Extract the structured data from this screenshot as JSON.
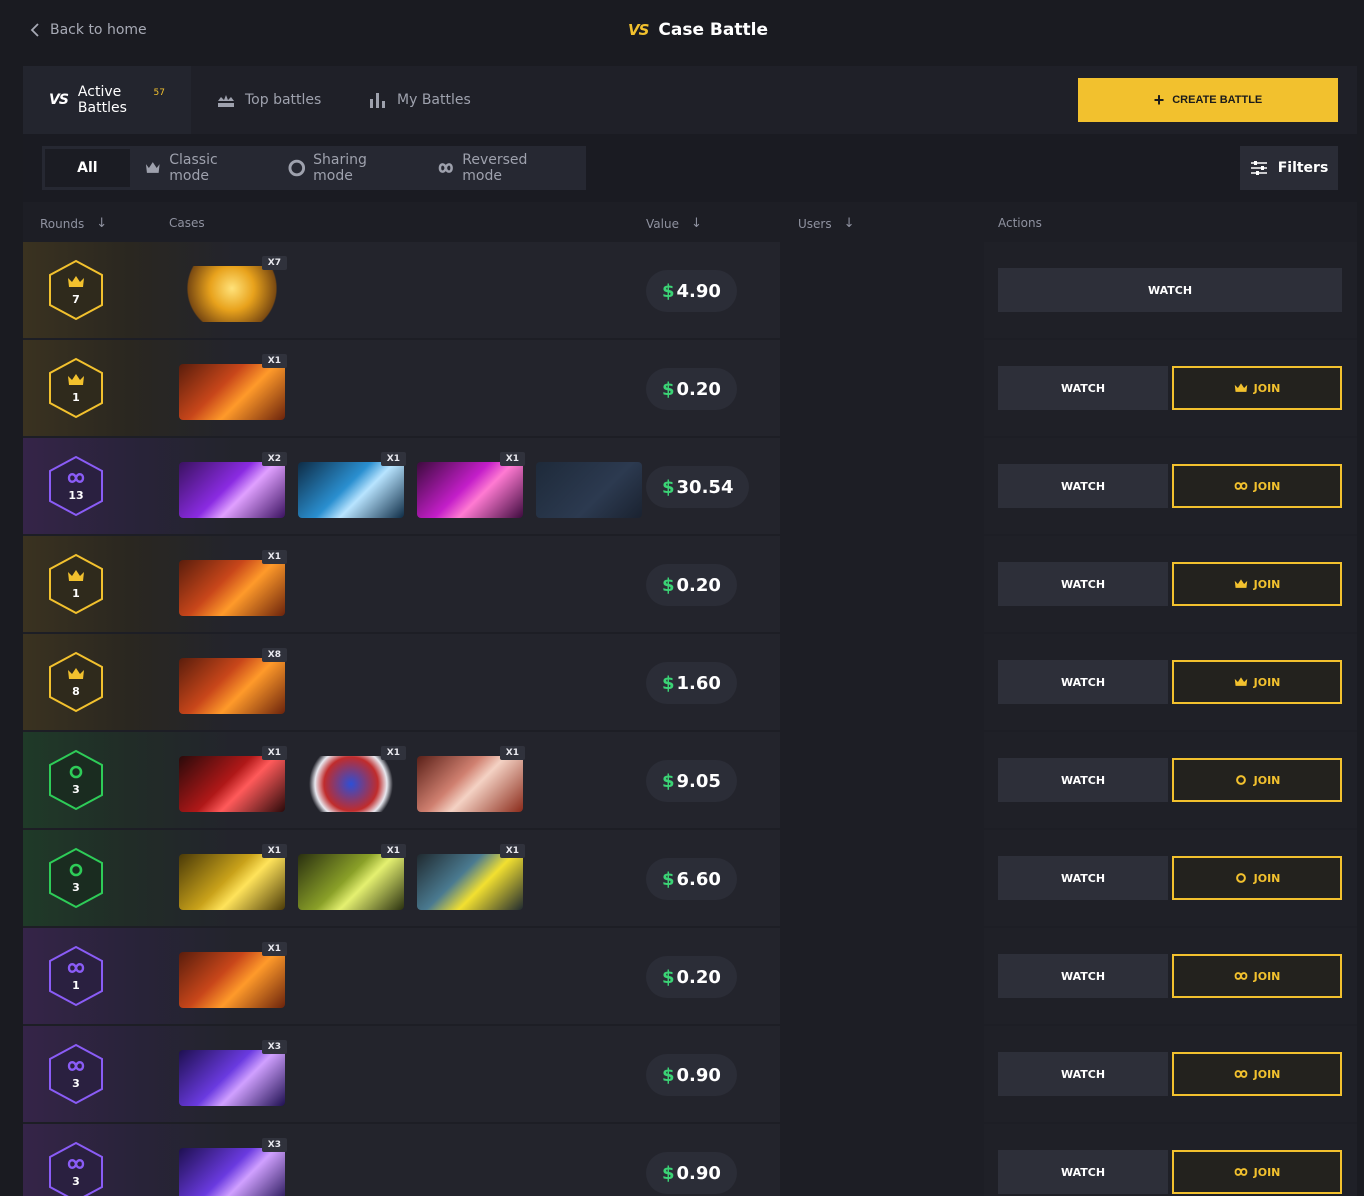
{
  "header": {
    "back_label": "Back to home",
    "title_badge": "VS",
    "title": "Case Battle"
  },
  "tabs": {
    "active_label": "Active Battles",
    "active_count": "57",
    "top_label": "Top battles",
    "my_label": "My Battles",
    "create_label": "CREATE BATTLE"
  },
  "modes": {
    "all": "All",
    "classic": "Classic mode",
    "sharing": "Sharing mode",
    "reversed": "Reversed mode",
    "filters": "Filters"
  },
  "columns": {
    "rounds": "Rounds",
    "cases": "Cases",
    "value": "Value",
    "users": "Users",
    "actions": "Actions"
  },
  "buttons": {
    "watch": "WATCH",
    "join": "JOIN"
  },
  "currency_symbol": "$",
  "colors": {
    "accent": "#f2c12e",
    "money": "#3bd375",
    "classic": "#f2c12e",
    "sharing": "#2ecc58",
    "reversed": "#8a5cf6"
  },
  "battles": [
    {
      "mode": "classic",
      "rounds": "7",
      "value": "4.90",
      "joinable": false,
      "cases": [
        {
          "qty": "X7",
          "theme": "gem"
        }
      ]
    },
    {
      "mode": "classic",
      "rounds": "1",
      "value": "0.20",
      "joinable": true,
      "cases": [
        {
          "qty": "X1",
          "theme": "fire"
        }
      ]
    },
    {
      "mode": "reversed",
      "rounds": "13",
      "value": "30.54",
      "joinable": true,
      "cases": [
        {
          "qty": "X2",
          "theme": "purple"
        },
        {
          "qty": "X1",
          "theme": "blue"
        },
        {
          "qty": "X1",
          "theme": "magenta"
        },
        {
          "qty": "",
          "theme": "dark"
        }
      ]
    },
    {
      "mode": "classic",
      "rounds": "1",
      "value": "0.20",
      "joinable": true,
      "cases": [
        {
          "qty": "X1",
          "theme": "fire"
        }
      ]
    },
    {
      "mode": "classic",
      "rounds": "8",
      "value": "1.60",
      "joinable": true,
      "cases": [
        {
          "qty": "X8",
          "theme": "fire"
        }
      ]
    },
    {
      "mode": "sharing",
      "rounds": "3",
      "value": "9.05",
      "joinable": true,
      "cases": [
        {
          "qty": "X1",
          "theme": "red"
        },
        {
          "qty": "X1",
          "theme": "orb"
        },
        {
          "qty": "X1",
          "theme": "camo"
        }
      ]
    },
    {
      "mode": "sharing",
      "rounds": "3",
      "value": "6.60",
      "joinable": true,
      "cases": [
        {
          "qty": "X1",
          "theme": "gold"
        },
        {
          "qty": "X1",
          "theme": "lime"
        },
        {
          "qty": "X1",
          "theme": "yellowgun"
        }
      ]
    },
    {
      "mode": "reversed",
      "rounds": "1",
      "value": "0.20",
      "joinable": true,
      "cases": [
        {
          "qty": "X1",
          "theme": "fire"
        }
      ]
    },
    {
      "mode": "reversed",
      "rounds": "3",
      "value": "0.90",
      "joinable": true,
      "cases": [
        {
          "qty": "X3",
          "theme": "violet"
        }
      ]
    },
    {
      "mode": "reversed",
      "rounds": "3",
      "value": "0.90",
      "joinable": true,
      "cases": [
        {
          "qty": "X3",
          "theme": "violet"
        }
      ]
    }
  ]
}
